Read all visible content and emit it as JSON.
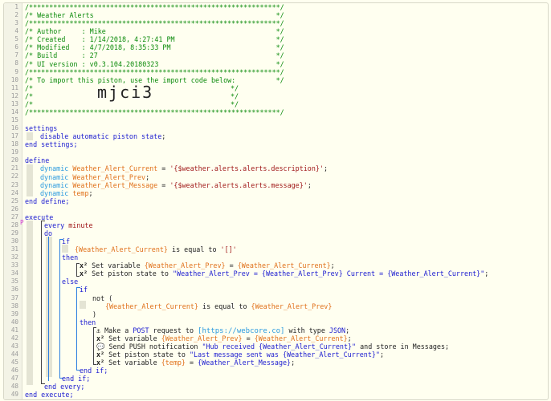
{
  "editor": {
    "line_numbers": [
      "1",
      "2",
      "3",
      "4",
      "5",
      "6",
      "7",
      "8",
      "9",
      "10",
      "11",
      "12",
      "13",
      "14",
      "15",
      "16",
      "17",
      "18",
      "19",
      "20",
      "21",
      "22",
      "23",
      "24",
      "25",
      "26",
      "27",
      "28",
      "29",
      "30",
      "31",
      "32",
      "33",
      "34",
      "35",
      "36",
      "37",
      "38",
      "39",
      "40",
      "41",
      "42",
      "43",
      "44",
      "45",
      "46",
      "47",
      "48",
      "49"
    ],
    "marker": "P",
    "code": {
      "l1": "/**************************************************************/",
      "l2": "/* Weather Alerts                                             */",
      "l3": "/**************************************************************/",
      "l4": "/* Author     : Mike                                          */",
      "l5": "/* Created    : 1/14/2018, 4:27:41 PM                         */",
      "l6": "/* Modified   : 4/7/2018, 8:35:33 PM                          */",
      "l7": "/* Build      : 27                                            */",
      "l8": "/* UI version : v0.3.104.20180323                             */",
      "l9": "/**************************************************************/",
      "l10": "/* To import this piston, use the import code below:          */",
      "l11a": "/*",
      "l11b": "*/",
      "l12a": "/*",
      "l12big": "mjci3",
      "l12b": "*/",
      "l13a": "/*",
      "l13b": "*/",
      "l14": "/**************************************************************/",
      "settings": "settings",
      "disable": "disable automatic piston state",
      "semicolon": ";",
      "end_settings": "end settings;",
      "define": "define",
      "dynamic": "dynamic",
      "var_current": "Weather_Alert_Current",
      "var_prev": "Weather_Alert_Prev",
      "var_message": "Weather_Alert_Message",
      "var_temp": "temp",
      "eq": " = ",
      "val_current": "'{$weather.alerts.alerts.description}'",
      "val_message": "'{$weather.alerts.alerts.message}'",
      "end_define": "end define;",
      "execute": "execute",
      "every": "every",
      "minute": "minute",
      "do": "do",
      "if": "if",
      "expr_current": "{Weather_Alert_Current}",
      "expr_prev": "{Weather_Alert_Prev}",
      "expr_message": "{Weather_Alert_Message}",
      "expr_temp": "{temp}",
      "is_equal_to": " is equal to ",
      "empty_list": "'[]'",
      "then": "then",
      "else": "else",
      "not_open": "not (",
      "close_paren": ")",
      "set_variable": "Set variable ",
      "set_piston_state": "Set piston state to ",
      "state_text_1": "\"Weather_Alert_Prev = {Weather_Alert_Prev} Current = {Weather_Alert_Current}\"",
      "make_a": "Make a ",
      "post": "POST",
      "request_to": " request to ",
      "url": "[https://webcore.co]",
      "with_type": " with type ",
      "json": "JSON",
      "send_push": "Send PUSH notification ",
      "push_text": "\"Hub received {Weather_Alert_Current}\"",
      "store_msgs": " and store in Messages;",
      "state_text_2": "\"Last message sent was {Weather_Alert_Current}\"",
      "end_if": "end if;",
      "end_every": "end every;",
      "end_execute": "end execute;",
      "var_icon": "x²",
      "post_icon": "⚓",
      "push_icon": "💬"
    }
  }
}
